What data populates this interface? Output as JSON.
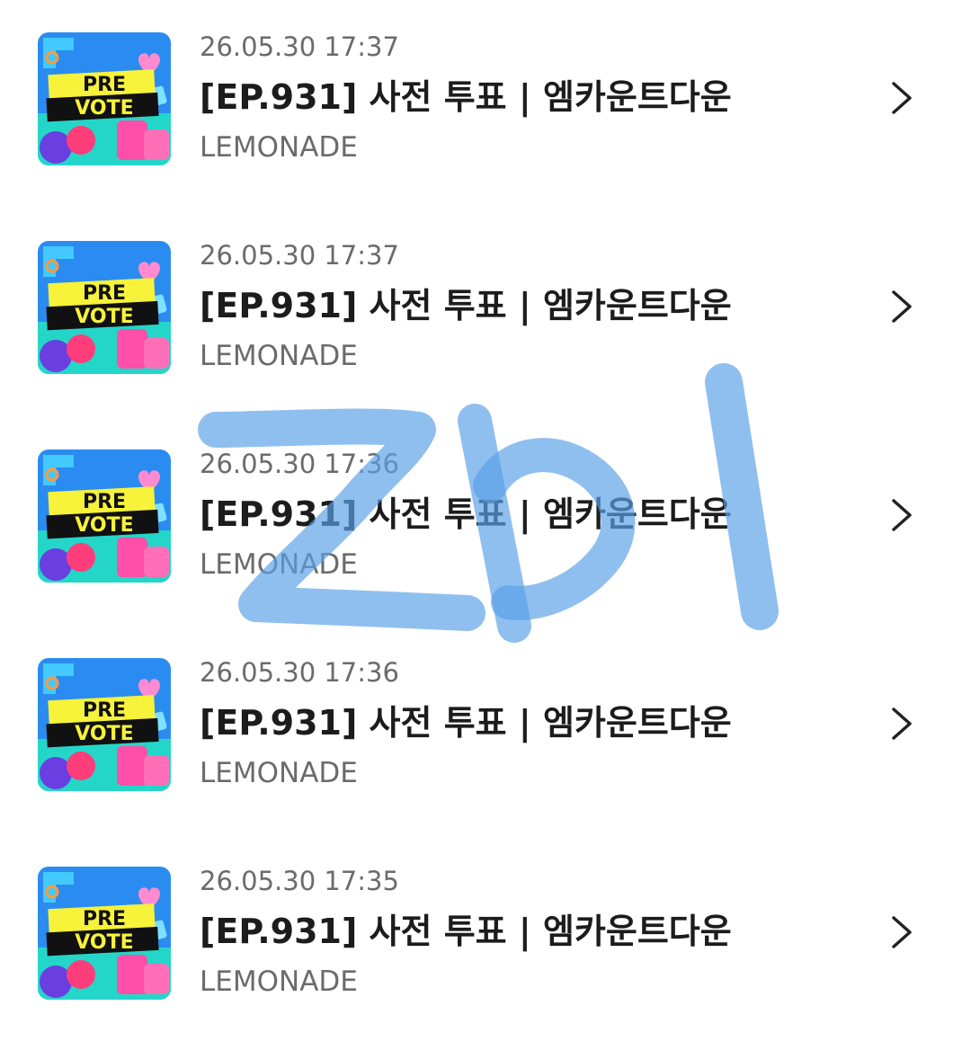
{
  "items": [
    {
      "date": "26.05.30 17:37",
      "title": "[EP.931] 사전 투표 | 엠카운트다운",
      "subtitle": "LEMONADE",
      "thumb_line1": "PRE",
      "thumb_line2": "VOTE"
    },
    {
      "date": "26.05.30 17:37",
      "title": "[EP.931] 사전 투표 | 엠카운트다운",
      "subtitle": "LEMONADE",
      "thumb_line1": "PRE",
      "thumb_line2": "VOTE"
    },
    {
      "date": "26.05.30 17:36",
      "title": "[EP.931] 사전 투표 | 엠카운트다운",
      "subtitle": "LEMONADE",
      "thumb_line1": "PRE",
      "thumb_line2": "VOTE"
    },
    {
      "date": "26.05.30 17:36",
      "title": "[EP.931] 사전 투표 | 엠카운트다운",
      "subtitle": "LEMONADE",
      "thumb_line1": "PRE",
      "thumb_line2": "VOTE"
    },
    {
      "date": "26.05.30 17:35",
      "title": "[EP.931] 사전 투표 | 엠카운트다운",
      "subtitle": "LEMONADE",
      "thumb_line1": "PRE",
      "thumb_line2": "VOTE"
    }
  ],
  "handwritten_overlay": "ZbI",
  "icons": {
    "row_arrow": "chevron-right-icon",
    "thumbnail": "pre-vote-thumbnail"
  },
  "colors": {
    "date_text": "#6b6b6b",
    "title_text": "#1c1c1c",
    "subtitle_text": "#6b6b6b",
    "overlay_marker": "#5aa0e8",
    "thumb_bg": "#2a8cf0",
    "thumb_banner": "#f7f23a"
  }
}
